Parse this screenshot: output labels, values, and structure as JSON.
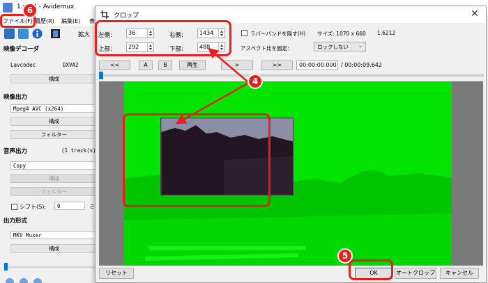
{
  "main_window": {
    "title": "1.mp4 - Avidemux",
    "menus": [
      "ファイル(F)",
      "履歴(R)",
      "編集(E)",
      "表"
    ],
    "toolbar_zoom_label": "拡大",
    "sections": {
      "video_decoder": {
        "title": "映像デコーダ",
        "decoder_name": "Lavcodec",
        "decoder_value": "DXVA2",
        "config_label": "構成"
      },
      "video_output": {
        "title": "映像出力",
        "codec": "Mpeg4 AVC (x264)",
        "config_label": "構成",
        "filters_label": "フィルター"
      },
      "audio_output": {
        "title": "音声出力",
        "tracks": "(1 track(s)",
        "codec": "Copy",
        "config_label": "構成",
        "filters_label": "フィルター",
        "shift_label": "シフト(S):",
        "shift_value": "0",
        "shift_unit": "ミ"
      },
      "output_format": {
        "title": "出力形式",
        "muxer": "MKV Muxer",
        "config_label": "構成"
      }
    }
  },
  "crop_dialog": {
    "title": "クロップ",
    "close_symbol": "✕",
    "left_label": "左側:",
    "left_value": "36",
    "right_label": "右側:",
    "right_value": "1434",
    "top_label": "上部:",
    "top_value": "292",
    "bottom_label": "下部:",
    "bottom_value": "488",
    "rubber_band_label": "ラバーバンドを隠す(H)",
    "size_label": "サイズ: 1070 x 660",
    "ratio_value": "1.6212",
    "aspect_label": "アスペクト比を固定:",
    "aspect_option": "ロックしない",
    "nav_buttons": [
      "<<",
      "A",
      "B",
      "再生",
      ">",
      ">>"
    ],
    "current_time": "00:00:00.000",
    "total_time": "/ 00:00:09.642",
    "reset_label": "リセット",
    "ok_label": "OK",
    "autocrop_label": "オートクロップ",
    "cancel_label": "キャンセル"
  },
  "annotations": {
    "step4": "4",
    "step5": "5",
    "step6": "6"
  },
  "colors": {
    "annotation_red": "#e8201c",
    "video_green": "#00e400",
    "accent_blue": "#0078d7"
  }
}
